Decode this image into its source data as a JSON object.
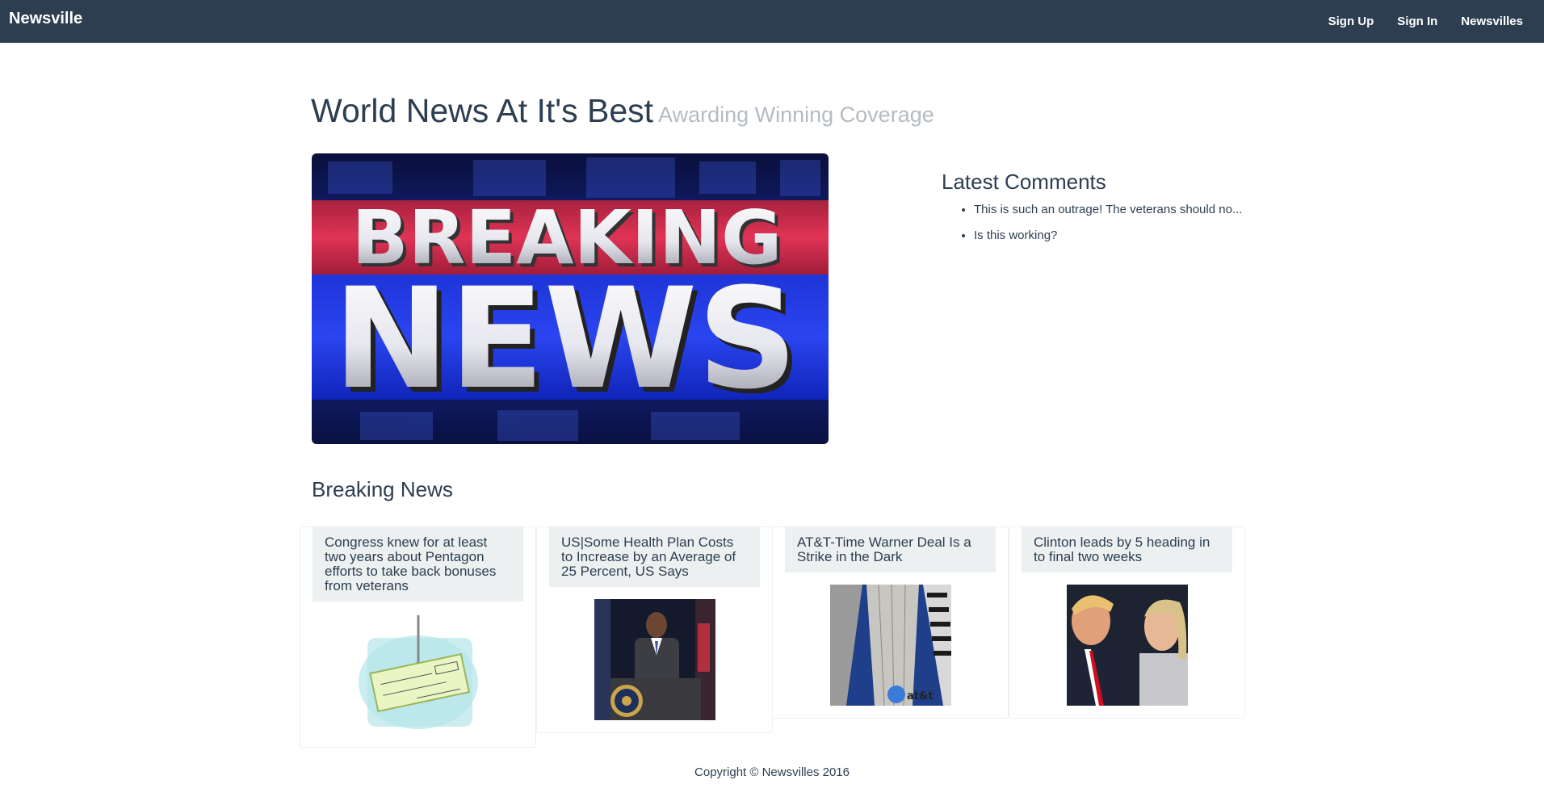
{
  "navbar": {
    "brand": "Newsville",
    "links": [
      "Sign Up",
      "Sign In",
      "Newsvilles"
    ]
  },
  "header": {
    "title": "World News At It's Best",
    "subtitle": "Awarding Winning Coverage"
  },
  "hero": {
    "line1": "BREAKING",
    "line2": "NEWS"
  },
  "comments": {
    "title": "Latest Comments",
    "items": [
      "This is such an outrage! The veterans should no...",
      "Is this working?"
    ]
  },
  "breaking": {
    "title": "Breaking News",
    "articles": [
      {
        "headline": "Congress knew for at least two years about Pentagon efforts to take back bonuses from veterans",
        "image": "check-on-hook"
      },
      {
        "headline": "US|Some Health Plan Costs to Increase by an Average of 25 Percent, US Says",
        "image": "speaker-at-podium"
      },
      {
        "headline": "AT&T-Time Warner Deal Is a Strike in the Dark",
        "image": "att-building"
      },
      {
        "headline": "Clinton leads by 5 heading in to final two weeks",
        "image": "two-candidates"
      }
    ]
  },
  "footer": {
    "copyright": "Copyright © Newsvilles 2016"
  },
  "colors": {
    "navbar": "#2c3e50",
    "muted": "#b4bcc2",
    "card_header": "#ecf0f1"
  }
}
